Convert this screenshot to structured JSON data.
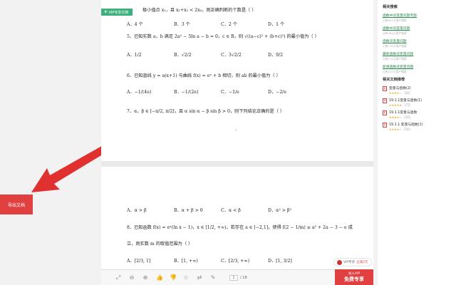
{
  "left": {
    "export_label": "导出文档"
  },
  "page1": {
    "vip_tag": "VIP专享文档",
    "q4_tail": "极小值点 x₁，且 x₁+x₂ < 2x₀，则正确判断的个数是（ ）",
    "q4_opts": [
      "A．4 个",
      "B．3 个",
      "C．2 个",
      "D．1 个"
    ],
    "q5": "5．已知实数 a，b 满足 2a² − 5ln a − b = 0，c ∈ R，则 √((a−c)² + (b+c)²) 的最小值为（ ）",
    "q5_opts": [
      "A．1/2",
      "B．√2/2",
      "C．3√2/2",
      "D．9/2"
    ],
    "q6": "6．已知直线 y = a(x+1) 与曲线 f(x) = eˣ + b 相切，则 ab 的最小值为（ ）",
    "q6_opts": [
      "A．−1/(4e)",
      "B．−1/(2e)",
      "C．−1/e",
      "D．−2/e"
    ],
    "q7": "7．α，β ∈ [−π/2, π/2]，且 α sin α − β sin β > 0，则下列结论正确的是（ ）",
    "page_mark": "1"
  },
  "page2": {
    "q7_opts": [
      "A．α > β",
      "B．α + β > 0",
      "C．α < β",
      "D．α² > β²"
    ],
    "q8": "8．已知函数 f(x) = eˣ(ln x − 1)，x ∈ [1/2, +∞)，若存在 a ∈ [−2,1]，使得 f(2 − 1/m) ≤ a² + 2a − 3 − e 成",
    "q8_cont": "立，则实数 m 的取值范围为（ ）",
    "q8_opts": [
      "A．[2/3, 1]",
      "B．[1, +∞)",
      "C．[2/3, +∞)",
      "D．[1, 3/2]"
    ]
  },
  "toolbar": {
    "icons": [
      "fullscreen-icon",
      "zoom-out-icon",
      "zoom-in-icon",
      "thumbs-up-icon",
      "thumbs-down-icon",
      "star-icon",
      "share-icon",
      "edit-icon"
    ],
    "page_current": "1",
    "page_total": "/ 18"
  },
  "vip_float": {
    "text": "VIP专享",
    "highlight": "立减2元"
  },
  "vip_button": {
    "small": "加入VIP",
    "big": "免费专享"
  },
  "sidebar": {
    "searches_title": "相关搜索",
    "searches": [
      {
        "label": "函数中双变量问题专题",
        "count": "已有903万用户搜索"
      },
      {
        "label": "函数中双变量问题",
        "count": "已有264万用户搜索"
      },
      {
        "label": "函数双变量问题",
        "count": "已有178万用户搜索"
      },
      {
        "label": "最新函数双变量问题",
        "count": "已有175万用户搜索"
      },
      {
        "label": "新课函数双变量问题",
        "count": "已有275万用户搜索"
      }
    ],
    "docs_title": "相关文档推荐",
    "docs": [
      {
        "title": "变量与函数(2)",
        "rating": 4,
        "pages": "16页"
      },
      {
        "title": "19.1.1变量与函数(1)",
        "rating": 5,
        "pages": "17页"
      },
      {
        "title": "19.1.1变量与函数",
        "rating": 4,
        "pages": "20页"
      },
      {
        "title": "19.1.1 变量与函数(1)",
        "rating": 4,
        "pages": "29页"
      }
    ]
  },
  "colors": {
    "accent_red": "#e04040",
    "link_green": "#2d8a4e",
    "vip_green": "#3fb07c"
  }
}
